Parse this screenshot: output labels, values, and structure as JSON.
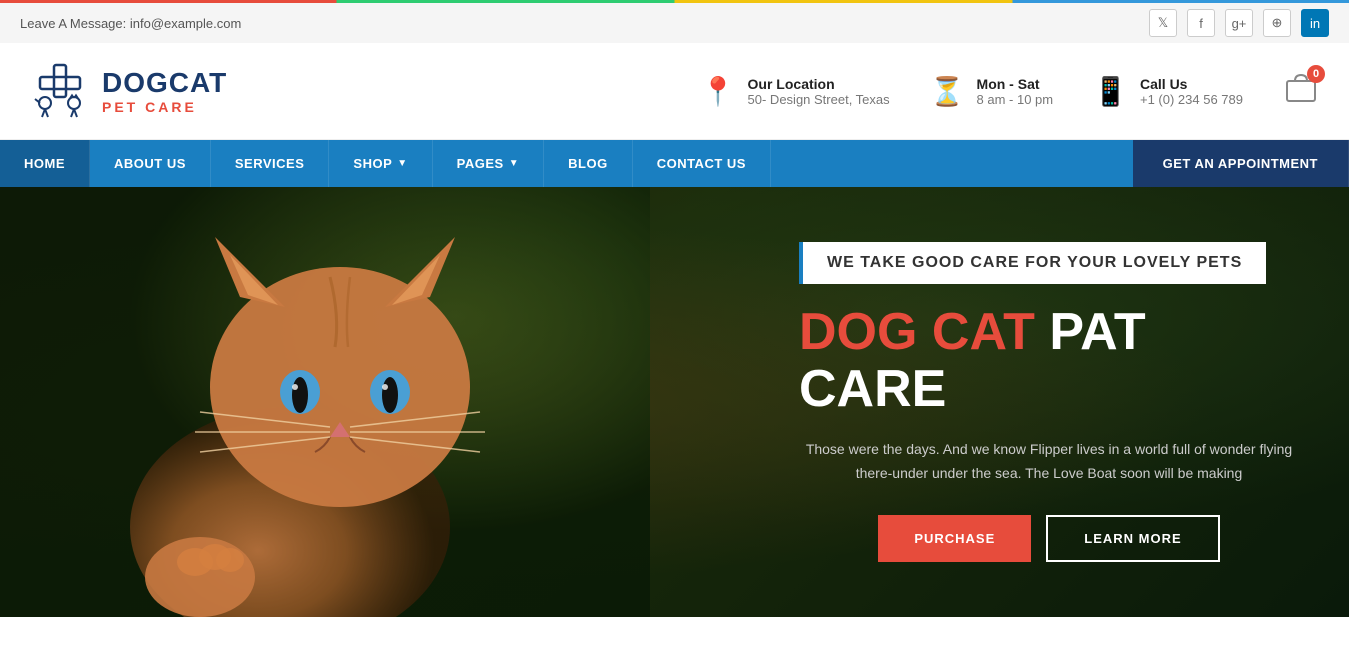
{
  "topbar": {
    "message": "Leave A Message: info@example.com",
    "social": [
      "twitter",
      "facebook",
      "google-plus",
      "globe",
      "linkedin"
    ]
  },
  "header": {
    "logo": {
      "brand": "DOGCAT",
      "sub": "PET CARE"
    },
    "location": {
      "label": "Our Location",
      "value": "50- Design Street, Texas"
    },
    "hours": {
      "label": "Mon - Sat",
      "value": "8 am - 10 pm"
    },
    "phone": {
      "label": "Call Us",
      "value": "+1 (0) 234 56 789"
    },
    "cart_count": "0"
  },
  "nav": {
    "items": [
      {
        "label": "HOME",
        "active": true,
        "dropdown": false
      },
      {
        "label": "ABOUT US",
        "active": false,
        "dropdown": false
      },
      {
        "label": "SERVICES",
        "active": false,
        "dropdown": false
      },
      {
        "label": "SHOP",
        "active": false,
        "dropdown": true
      },
      {
        "label": "PAGES",
        "active": false,
        "dropdown": true
      },
      {
        "label": "BLOG",
        "active": false,
        "dropdown": false
      },
      {
        "label": "CONTACT US",
        "active": false,
        "dropdown": false
      }
    ],
    "cta": "GET AN APPOINTMENT"
  },
  "hero": {
    "tag": "WE TAKE GOOD CARE FOR YOUR LOVELY PETS",
    "title_orange": "DOG CAT",
    "title_white": "PAT CARE",
    "description": "Those were the days. And we know Flipper lives in a world full of wonder flying there-under under the sea. The Love Boat soon will be making",
    "btn_purchase": "PURCHASE",
    "btn_learn": "LEARN MORE"
  }
}
